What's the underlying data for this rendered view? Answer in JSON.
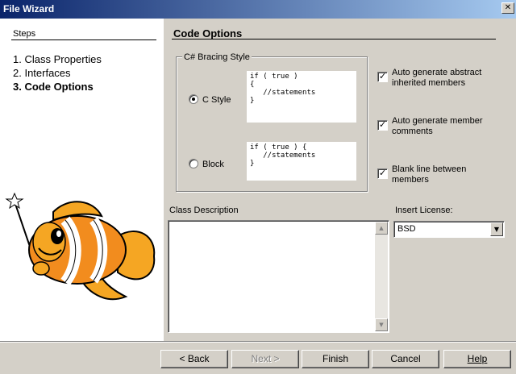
{
  "window": {
    "title": "File Wizard"
  },
  "steps": {
    "heading": "Steps",
    "items": [
      "1. Class Properties",
      "2. Interfaces",
      "3. Code Options"
    ]
  },
  "section": {
    "title": "Code Options"
  },
  "bracing": {
    "title": "C# Bracing Style",
    "c_style": {
      "label": "C Style",
      "selected": true,
      "code": "if ( true )\n{\n   //statements\n}"
    },
    "block": {
      "label": "Block",
      "selected": false,
      "code": "if ( true ) {\n   //statements\n}"
    }
  },
  "options": [
    {
      "label": "Auto generate abstract inherited members",
      "checked": true
    },
    {
      "label": "Auto generate member comments",
      "checked": true
    },
    {
      "label": "Blank line between members",
      "checked": true
    }
  ],
  "description": {
    "label": "Class Description",
    "value": ""
  },
  "license": {
    "label": "Insert License:",
    "value": "BSD"
  },
  "buttons": {
    "back": "< Back",
    "next": "Next >",
    "finish": "Finish",
    "cancel": "Cancel",
    "help": "Help"
  },
  "colors": {
    "titlebar_start": "#0a246a",
    "titlebar_end": "#a6caf0",
    "dialog_bg": "#d4d0c8"
  }
}
